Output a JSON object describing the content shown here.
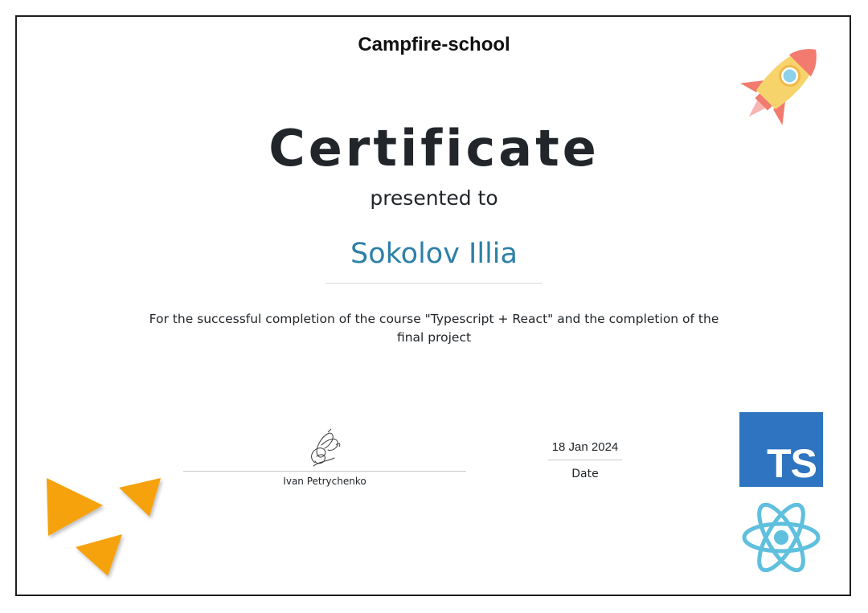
{
  "certificate": {
    "school": "Campfire-school",
    "title": "Certificate",
    "presented_to": "presented to",
    "recipient": "Sokolov Illia",
    "description": "For the successful completion of the course \"Typescript + React\" and the completion of the final project",
    "signer": "Ivan Petrychenko",
    "date_value": "18 Jan 2024",
    "date_label": "Date"
  },
  "badges": {
    "ts": "TS"
  },
  "icons": {
    "rocket": "rocket-icon",
    "typescript": "typescript-logo",
    "react": "react-logo",
    "triangles": "triangles-decoration",
    "signature": "signature-scribble"
  },
  "colors": {
    "recipient": "#2e80a8",
    "typescript": "#2f74c0",
    "react": "#5fc0de",
    "triangles": "#f5a20f",
    "rocket_body": "#f7d46b",
    "rocket_fins": "#f27a6e"
  }
}
